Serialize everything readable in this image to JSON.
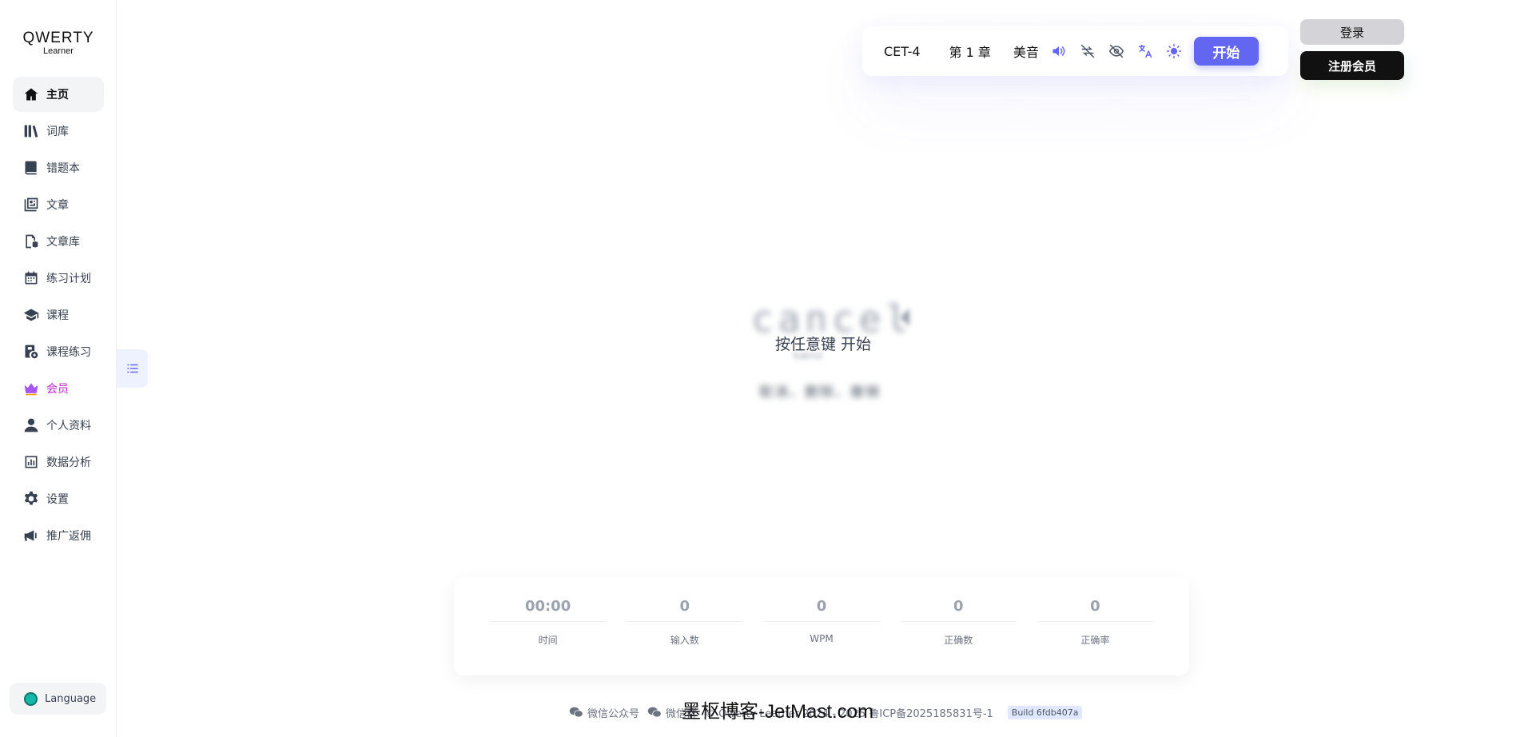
{
  "logo": {
    "line1": "QWERTY",
    "line2": "Learner"
  },
  "sidebar": {
    "items": [
      {
        "label": "主页",
        "icon": "home-icon"
      },
      {
        "label": "词库",
        "icon": "library-icon"
      },
      {
        "label": "错题本",
        "icon": "notebook-icon"
      },
      {
        "label": "文章",
        "icon": "article-icon"
      },
      {
        "label": "文章库",
        "icon": "article-library-icon"
      },
      {
        "label": "练习计划",
        "icon": "calendar-icon"
      },
      {
        "label": "课程",
        "icon": "graduation-cap-icon"
      },
      {
        "label": "课程练习",
        "icon": "course-practice-icon"
      },
      {
        "label": "会员",
        "icon": "crown-icon"
      },
      {
        "label": "个人资料",
        "icon": "user-icon"
      },
      {
        "label": "数据分析",
        "icon": "chart-icon"
      },
      {
        "label": "设置",
        "icon": "gear-icon"
      },
      {
        "label": "推广返佣",
        "icon": "megaphone-icon"
      }
    ],
    "language": "Language"
  },
  "toolbar": {
    "dict": "CET-4",
    "chapter": "第 1 章",
    "accent": "美音",
    "start": "开始"
  },
  "auth": {
    "login": "登录",
    "register": "注册会员"
  },
  "word": {
    "text": "cancel",
    "phonetic": "ˈkænsl",
    "translation": "取消、删除、撤销",
    "hint": "按任意键 开始"
  },
  "stats": [
    {
      "value": "00:00",
      "label": "时间"
    },
    {
      "value": "0",
      "label": "输入数"
    },
    {
      "value": "0",
      "label": "WPM"
    },
    {
      "value": "0",
      "label": "正确数"
    },
    {
      "value": "0",
      "label": "正确率"
    }
  ],
  "footer": {
    "wechat_public": "微信公众号",
    "wechat_group": "微信群",
    "copyright": "© Qwerty Learner 2024 - 2025 鲁ICP备2025185831号-1",
    "build": "Build 6fdb407a"
  },
  "watermark": "墨枢博客-JetMast.com",
  "colors": {
    "accent": "#6366f1",
    "vip": "#c026d3"
  }
}
